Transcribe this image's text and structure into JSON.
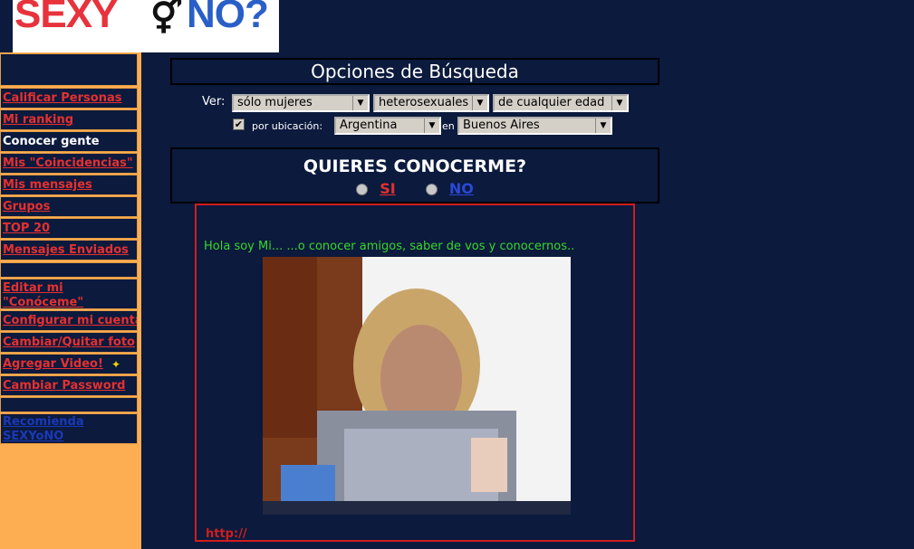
{
  "logo": {
    "part1": "SEXY",
    "symbol": "⚥",
    "part2": "NO?"
  },
  "sidebar": {
    "items1": [
      {
        "label": "Calificar Personas",
        "current": false
      },
      {
        "label": "Mi ranking",
        "current": false
      },
      {
        "label": "Conocer gente",
        "current": true
      },
      {
        "label": "Mis \"Coincidencias\"",
        "current": false
      },
      {
        "label": "Mis mensajes",
        "current": false
      },
      {
        "label": "Grupos",
        "current": false
      },
      {
        "label": "TOP 20",
        "current": false
      },
      {
        "label": "Mensajes Enviados",
        "current": false
      }
    ],
    "items2": [
      {
        "label": "Editar mi"
      },
      {
        "label": "\"Conóceme\""
      },
      {
        "label": "Configurar mi cuenta"
      },
      {
        "label": "Cambiar/Quitar foto"
      },
      {
        "label": "Agregar Video!"
      },
      {
        "label": "Cambiar Password"
      }
    ],
    "recommend": [
      "Recomienda",
      "SEXYoNO"
    ]
  },
  "search": {
    "title": "Opciones de Búsqueda",
    "ver_label": "Ver:",
    "gender": "sólo mujeres",
    "orientation": "heterosexuales",
    "age": "de cualquier edad",
    "location_label": "por ubicación:",
    "country": "Argentina",
    "en_label": "en",
    "city": "Buenos Aires",
    "location_checked": true
  },
  "meet": {
    "title": "QUIERES CONOCERME?",
    "yes": "SI",
    "no": "NO"
  },
  "profile": {
    "intro": "Hola soy Mi...  ...o conocer amigos, saber de vos y conocernos..",
    "url_prefix": "http://"
  },
  "colors": {
    "background": "#0b1a3d",
    "sidebar": "#fdae52",
    "link_red": "#e63030",
    "intro_green": "#37d62c",
    "border_red": "#d01d1d"
  }
}
